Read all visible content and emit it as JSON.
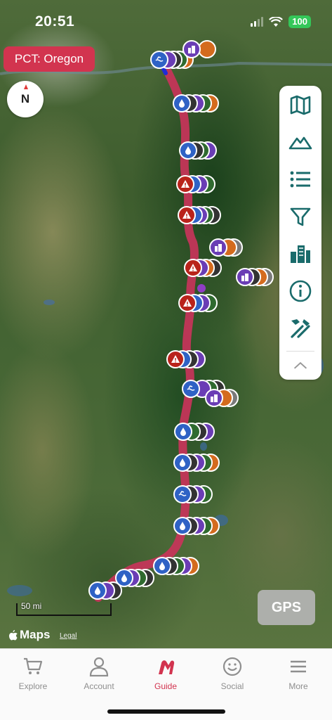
{
  "status_bar": {
    "time": "20:51",
    "battery": "100"
  },
  "region": {
    "label": "PCT: Oregon"
  },
  "compass": {
    "label": "N"
  },
  "toolbar": {
    "items": [
      {
        "icon": "map-icon"
      },
      {
        "icon": "mountain-icon"
      },
      {
        "icon": "list-icon"
      },
      {
        "icon": "filter-icon"
      },
      {
        "icon": "buildings-icon"
      },
      {
        "icon": "info-icon"
      },
      {
        "icon": "tools-icon"
      },
      {
        "icon": "chevron-up-icon"
      }
    ]
  },
  "map": {
    "scale_label": "50 mi",
    "attribution": "Maps",
    "legal": "Legal"
  },
  "gps_button": {
    "label": "GPS"
  },
  "tabs": [
    {
      "label": "Explore",
      "icon": "cart-icon",
      "active": false
    },
    {
      "label": "Account",
      "icon": "person-icon",
      "active": false
    },
    {
      "label": "Guide",
      "icon": "guide-logo-icon",
      "active": true
    },
    {
      "label": "Social",
      "icon": "smiley-icon",
      "active": false
    },
    {
      "label": "More",
      "icon": "menu-icon",
      "active": false
    }
  ],
  "colors": {
    "accent": "#d2344f",
    "toolbar_icon": "#1a6b6b",
    "route": "#c8345a"
  }
}
